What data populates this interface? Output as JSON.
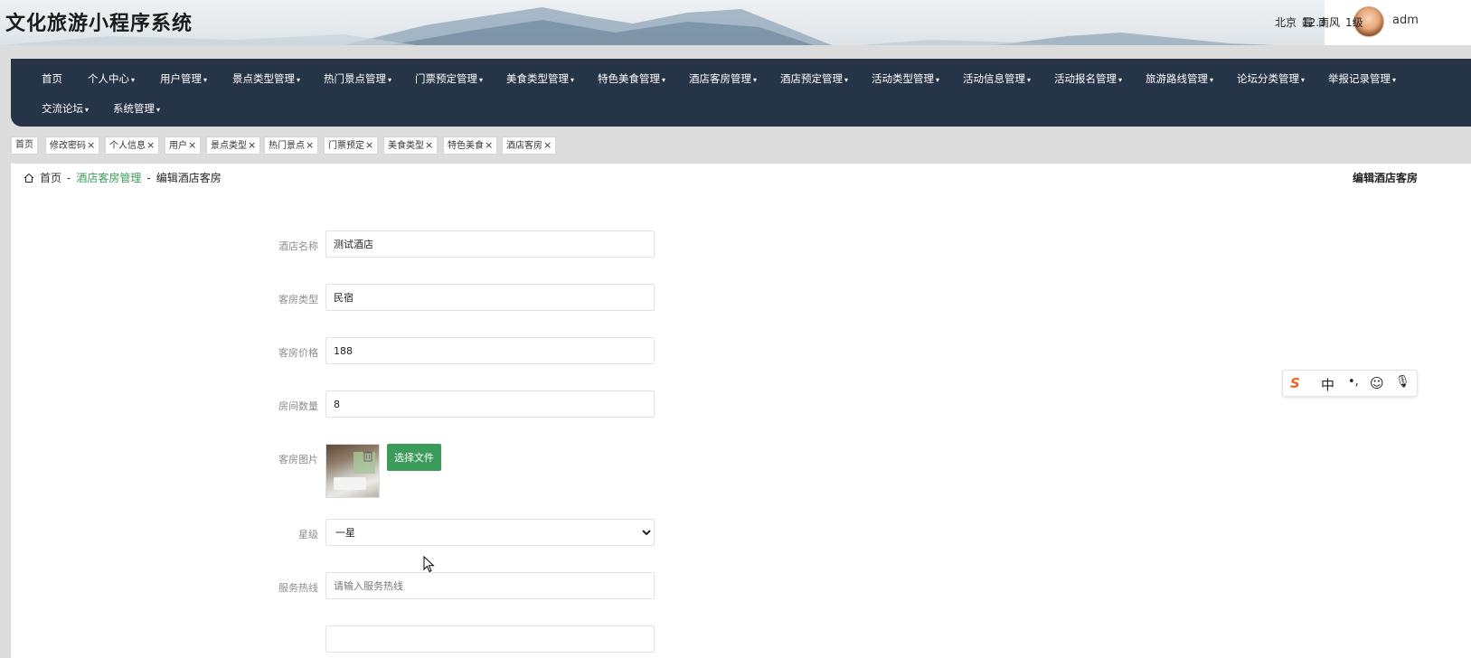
{
  "header": {
    "title": "文化旅游小程序系统",
    "weather": {
      "city": "北京",
      "temp": "12.3°",
      "condition": "霾",
      "wind": "南风",
      "level": "1级"
    },
    "username": "adm"
  },
  "nav": {
    "row1": [
      {
        "label": "首页",
        "dropdown": false
      },
      {
        "label": "个人中心",
        "dropdown": true
      },
      {
        "label": "用户管理",
        "dropdown": true
      },
      {
        "label": "景点类型管理",
        "dropdown": true
      },
      {
        "label": "热门景点管理",
        "dropdown": true
      },
      {
        "label": "门票预定管理",
        "dropdown": true
      },
      {
        "label": "美食类型管理",
        "dropdown": true
      },
      {
        "label": "特色美食管理",
        "dropdown": true
      },
      {
        "label": "酒店客房管理",
        "dropdown": true
      },
      {
        "label": "酒店预定管理",
        "dropdown": true
      },
      {
        "label": "活动类型管理",
        "dropdown": true
      },
      {
        "label": "活动信息管理",
        "dropdown": true
      },
      {
        "label": "活动报名管理",
        "dropdown": true
      },
      {
        "label": "旅游路线管理",
        "dropdown": true
      },
      {
        "label": "论坛分类管理",
        "dropdown": true
      },
      {
        "label": "举报记录管理",
        "dropdown": true
      }
    ],
    "row2": [
      {
        "label": "交流论坛",
        "dropdown": true
      },
      {
        "label": "系统管理",
        "dropdown": true
      }
    ],
    "caret": "▾"
  },
  "tabs": [
    {
      "label": "首页",
      "closable": false
    },
    {
      "label": "修改密码",
      "closable": true
    },
    {
      "label": "个人信息",
      "closable": true
    },
    {
      "label": "用户",
      "closable": true
    },
    {
      "label": "景点类型",
      "closable": true
    },
    {
      "label": "热门景点",
      "closable": true
    },
    {
      "label": "门票预定",
      "closable": true
    },
    {
      "label": "美食类型",
      "closable": true
    },
    {
      "label": "特色美食",
      "closable": true
    },
    {
      "label": "酒店客房",
      "closable": true
    }
  ],
  "tab_close_glyph": "×",
  "breadcrumb": {
    "home": "首页",
    "sep": "-",
    "parent": "酒店客房管理",
    "current": "编辑酒店客房"
  },
  "page_title_right": "编辑酒店客房",
  "form": {
    "hotel_name": {
      "label": "酒店名称",
      "value": "测试酒店"
    },
    "room_type": {
      "label": "客房类型",
      "value": "民宿"
    },
    "room_price": {
      "label": "客房价格",
      "value": "188"
    },
    "room_count": {
      "label": "房间数量",
      "value": "8"
    },
    "room_image": {
      "label": "客房图片",
      "button": "选择文件"
    },
    "star_level": {
      "label": "星级",
      "value": "一星"
    },
    "service_hotline": {
      "label": "服务热线",
      "placeholder": "请输入服务热线"
    }
  },
  "ime": {
    "logo": "S",
    "mode": "中",
    "punct": "•,",
    "emoji": "☺",
    "mic": "🎙"
  },
  "colors": {
    "nav_bg": "#253547",
    "accent_green": "#3a9b5a",
    "ime_logo": "#f26522"
  }
}
